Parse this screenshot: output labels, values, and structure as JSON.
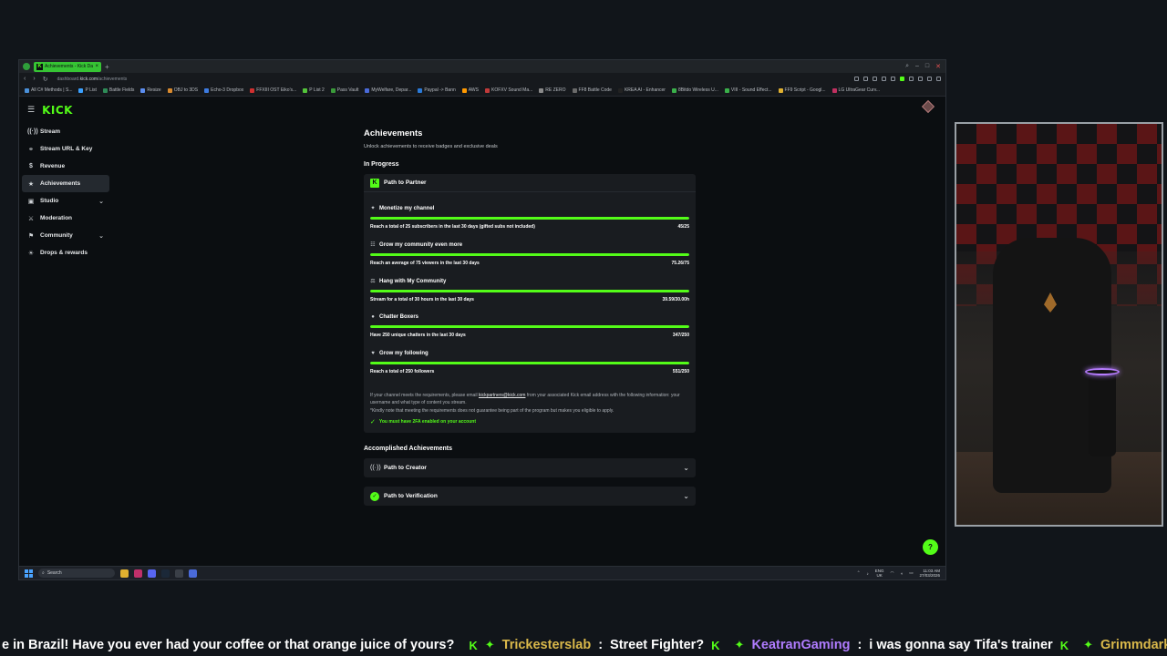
{
  "browser": {
    "tab_title": "Achievements - Kick Dasl",
    "url_prefix": "dashboard.",
    "url_domain": "kick.com",
    "url_path": "/achievements",
    "bookmarks": [
      {
        "label": "All C# Methods | S...",
        "color": "#4a90d9"
      },
      {
        "label": "P List",
        "color": "#3aa0ff"
      },
      {
        "label": "Battle Fields",
        "color": "#2e8b57"
      },
      {
        "label": "Resize",
        "color": "#5b8def"
      },
      {
        "label": "OBJ to 3DS",
        "color": "#d98a2e"
      },
      {
        "label": "Echo-3 Dropbox",
        "color": "#3d7be0"
      },
      {
        "label": "FFXIII OST Eiko's...",
        "color": "#d03030"
      },
      {
        "label": "P List 2",
        "color": "#53c43a"
      },
      {
        "label": "Pass Vault",
        "color": "#3a9a3a"
      },
      {
        "label": "MyWelfare, Depar...",
        "color": "#4a6ad9"
      },
      {
        "label": "Paypal -> Bann",
        "color": "#2a7ad9"
      },
      {
        "label": "AWS",
        "color": "#ff9900"
      },
      {
        "label": "KOFXV Sound Ma...",
        "color": "#c03a3a"
      },
      {
        "label": "RE ZERO",
        "color": "#8a8a8a"
      },
      {
        "label": "FF8 Battle Code",
        "color": "#6a6a6a"
      },
      {
        "label": "KREA AI - Enhancer",
        "color": "#222222"
      },
      {
        "label": "8Bitdo Wireless U...",
        "color": "#3ab04a"
      },
      {
        "label": "VIII - Sound Effect...",
        "color": "#3ab04a"
      },
      {
        "label": "FF9 Script - Googl...",
        "color": "#e0b030"
      },
      {
        "label": "LG UltraGear Curv...",
        "color": "#c03060"
      }
    ]
  },
  "sidebar": {
    "logo": "KICK",
    "items": [
      {
        "label": "Stream",
        "icon": "broadcast-icon",
        "glyph": "((·))"
      },
      {
        "label": "Stream URL & Key",
        "icon": "link-icon",
        "glyph": "⚭"
      },
      {
        "label": "Revenue",
        "icon": "dollar-icon",
        "glyph": "$"
      },
      {
        "label": "Achievements",
        "icon": "trophy-icon",
        "glyph": "★"
      },
      {
        "label": "Studio",
        "icon": "studio-icon",
        "glyph": "▣"
      },
      {
        "label": "Moderation",
        "icon": "sword-icon",
        "glyph": "⚔"
      },
      {
        "label": "Community",
        "icon": "community-icon",
        "glyph": "⚑"
      },
      {
        "label": "Drops & rewards",
        "icon": "gift-icon",
        "glyph": "☀"
      }
    ]
  },
  "main": {
    "title": "Achievements",
    "subtitle": "Unlock achievements to receive badges and exclusive deals",
    "in_progress_heading": "In Progress",
    "partner_card": {
      "title": "Path to Partner",
      "requirements": [
        {
          "title": "Monetize my channel",
          "icon": "sparkle-icon",
          "glyph": "✦",
          "description": "Reach a total of 25 subscribers in the last 30 days (gifted subs not included)",
          "progress_text": "45/25",
          "progress": 1.0
        },
        {
          "title": "Grow my community even more",
          "icon": "people-icon",
          "glyph": "☷",
          "description": "Reach an average of 75 viewers in the last 30 days",
          "progress_text": "75.26/75",
          "progress": 1.0
        },
        {
          "title": "Hang with My Community",
          "icon": "hands-icon",
          "glyph": "⚖",
          "description": "Stream for a total of 30 hours in the last 30 days",
          "progress_text": "39.59/30.00h",
          "progress": 1.0
        },
        {
          "title": "Chatter Boxers",
          "icon": "chat-icon",
          "glyph": "●",
          "description": "Have 250 unique chatters in the last 30 days",
          "progress_text": "347/250",
          "progress": 1.0
        },
        {
          "title": "Grow my following",
          "icon": "heart-icon",
          "glyph": "♥",
          "description": "Reach a total of 250 followers",
          "progress_text": "551/250",
          "progress": 1.0
        }
      ],
      "note_before": "If your channel meets the requirements, please email ",
      "note_email": "kickpartners@kick.com",
      "note_after": " from your associated Kick email address with the following information: your username and what type of content you stream.",
      "note_disclaimer": "*Kindly note that meeting the requirements does not guarantee being part of the program but makes you eligible to apply.",
      "twofa_text": "You must have 2FA enabled on your account"
    },
    "accomplished_heading": "Accomplished Achievements",
    "accomplished": [
      {
        "title": "Path to Creator",
        "icon": "broadcast-icon"
      },
      {
        "title": "Path to Verification",
        "icon": "verified-badge-icon"
      }
    ]
  },
  "taskbar": {
    "search_placeholder": "Search",
    "language": "ENG",
    "region": "UK",
    "time": "11:03 AM",
    "date": "27/03/2026"
  },
  "ticker": {
    "msg1": "e in Brazil! Have you ever had your coffee or that orange juice of yours?",
    "user1": "Trickesterslab",
    "msg2": "Street Fighter?",
    "user2": "KeatranGaming",
    "msg3": "i was gonna say Tifa's trainer",
    "user3": "Grimmdark",
    "sep": ":",
    "user1_color": "#d9b84a",
    "user2_color": "#b07cff",
    "user3_color": "#d9b84a"
  }
}
